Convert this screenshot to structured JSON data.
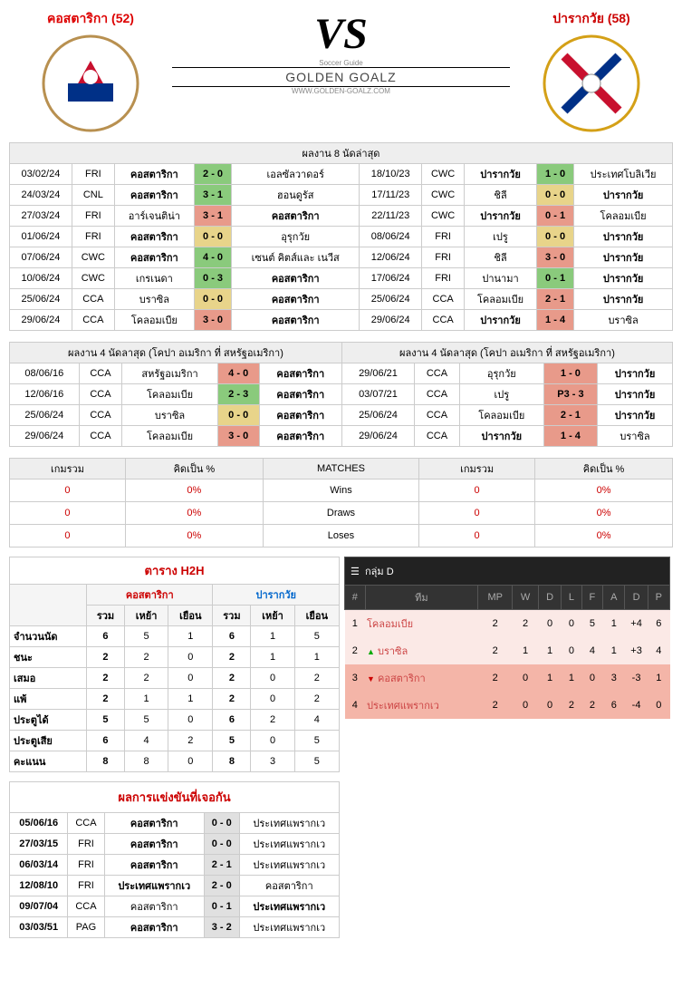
{
  "header": {
    "team_left": "คอสตาริกา (52)",
    "team_right": "ปารากวัย (58)",
    "vs": "VS",
    "logo_top": "Soccer Guide",
    "logo_main": "GOLDEN GOALZ",
    "logo_sub": "WWW.GOLDEN-GOALZ.COM"
  },
  "last8": {
    "title": "ผลงาน 8 นัดล่าสุด",
    "left": [
      {
        "date": "03/02/24",
        "comp": "FRI",
        "home": "คอสตาริกา",
        "score": "2 - 0",
        "cls": "green",
        "away": "เอลซัลวาดอร์",
        "hb": true
      },
      {
        "date": "24/03/24",
        "comp": "CNL",
        "home": "คอสตาริกา",
        "score": "3 - 1",
        "cls": "green",
        "away": "ฮอนดูรัส",
        "hb": true
      },
      {
        "date": "27/03/24",
        "comp": "FRI",
        "home": "อาร์เจนติน่า",
        "score": "3 - 1",
        "cls": "red",
        "away": "คอสตาริกา",
        "ab": true
      },
      {
        "date": "01/06/24",
        "comp": "FRI",
        "home": "คอสตาริกา",
        "score": "0 - 0",
        "cls": "yellow",
        "away": "อุรุกวัย",
        "hb": true
      },
      {
        "date": "07/06/24",
        "comp": "CWC",
        "home": "คอสตาริกา",
        "score": "4 - 0",
        "cls": "green",
        "away": "เซนต์ คิตส์และ เนวีส",
        "hb": true
      },
      {
        "date": "10/06/24",
        "comp": "CWC",
        "home": "เกรเนดา",
        "score": "0 - 3",
        "cls": "green",
        "away": "คอสตาริกา",
        "ab": true
      },
      {
        "date": "25/06/24",
        "comp": "CCA",
        "home": "บราซิล",
        "score": "0 - 0",
        "cls": "yellow",
        "away": "คอสตาริกา",
        "ab": true
      },
      {
        "date": "29/06/24",
        "comp": "CCA",
        "home": "โคลอมเบีย",
        "score": "3 - 0",
        "cls": "red",
        "away": "คอสตาริกา",
        "ab": true
      }
    ],
    "right": [
      {
        "date": "18/10/23",
        "comp": "CWC",
        "home": "ปารากวัย",
        "score": "1 - 0",
        "cls": "green",
        "away": "ประเทศโบลิเวีย",
        "hb": true
      },
      {
        "date": "17/11/23",
        "comp": "CWC",
        "home": "ชิลี",
        "score": "0 - 0",
        "cls": "yellow",
        "away": "ปารากวัย",
        "ab": true
      },
      {
        "date": "22/11/23",
        "comp": "CWC",
        "home": "ปารากวัย",
        "score": "0 - 1",
        "cls": "red",
        "away": "โคลอมเบีย",
        "hb": true
      },
      {
        "date": "08/06/24",
        "comp": "FRI",
        "home": "เปรู",
        "score": "0 - 0",
        "cls": "yellow",
        "away": "ปารากวัย",
        "ab": true
      },
      {
        "date": "12/06/24",
        "comp": "FRI",
        "home": "ชิลี",
        "score": "3 - 0",
        "cls": "red",
        "away": "ปารากวัย",
        "ab": true
      },
      {
        "date": "17/06/24",
        "comp": "FRI",
        "home": "ปานามา",
        "score": "0 - 1",
        "cls": "green",
        "away": "ปารากวัย",
        "ab": true
      },
      {
        "date": "25/06/24",
        "comp": "CCA",
        "home": "โคลอมเบีย",
        "score": "2 - 1",
        "cls": "red",
        "away": "ปารากวัย",
        "ab": true
      },
      {
        "date": "29/06/24",
        "comp": "CCA",
        "home": "ปารากวัย",
        "score": "1 - 4",
        "cls": "red",
        "away": "บราซิล",
        "hb": true
      }
    ]
  },
  "last4": {
    "title_left": "ผลงาน 4 นัดลาสุด (โคปา อเมริกา ที่ สหรัฐอเมริกา)",
    "title_right": "ผลงาน 4 นัดลาสุด (โคปา อเมริกา ที่ สหรัฐอเมริกา)",
    "left": [
      {
        "date": "08/06/16",
        "comp": "CCA",
        "home": "สหรัฐอเมริกา",
        "score": "4 - 0",
        "cls": "red",
        "away": "คอสตาริกา",
        "ab": true
      },
      {
        "date": "12/06/16",
        "comp": "CCA",
        "home": "โคลอมเบีย",
        "score": "2 - 3",
        "cls": "green",
        "away": "คอสตาริกา",
        "ab": true
      },
      {
        "date": "25/06/24",
        "comp": "CCA",
        "home": "บราซิล",
        "score": "0 - 0",
        "cls": "yellow",
        "away": "คอสตาริกา",
        "ab": true
      },
      {
        "date": "29/06/24",
        "comp": "CCA",
        "home": "โคลอมเบีย",
        "score": "3 - 0",
        "cls": "red",
        "away": "คอสตาริกา",
        "ab": true
      }
    ],
    "right": [
      {
        "date": "29/06/21",
        "comp": "CCA",
        "home": "อุรุกวัย",
        "score": "1 - 0",
        "cls": "red",
        "away": "ปารากวัย",
        "ab": true
      },
      {
        "date": "03/07/21",
        "comp": "CCA",
        "home": "เปรู",
        "score": "P3 - 3",
        "cls": "red",
        "away": "ปารากวัย",
        "ab": true
      },
      {
        "date": "25/06/24",
        "comp": "CCA",
        "home": "โคลอมเบีย",
        "score": "2 - 1",
        "cls": "red",
        "away": "ปารากวัย",
        "ab": true
      },
      {
        "date": "29/06/24",
        "comp": "CCA",
        "home": "ปารากวัย",
        "score": "1 - 4",
        "cls": "red",
        "away": "บราซิล",
        "hb": true
      }
    ]
  },
  "summary": {
    "headers": [
      "เกมรวม",
      "คิดเป็น %",
      "MATCHES",
      "เกมรวม",
      "คิดเป็น %"
    ],
    "rows": [
      {
        "l1": "0",
        "l2": "0%",
        "label": "Wins",
        "r1": "0",
        "r2": "0%"
      },
      {
        "l1": "0",
        "l2": "0%",
        "label": "Draws",
        "r1": "0",
        "r2": "0%"
      },
      {
        "l1": "0",
        "l2": "0%",
        "label": "Loses",
        "r1": "0",
        "r2": "0%"
      }
    ]
  },
  "h2h": {
    "title": "ตาราง H2H",
    "team_left": "คอสตาริกา",
    "team_right": "ปารากวัย",
    "cols": [
      "รวม",
      "เหย้า",
      "เยือน",
      "รวม",
      "เหย้า",
      "เยือน"
    ],
    "rows": [
      {
        "label": "จำนวนนัด",
        "v": [
          "6",
          "5",
          "1",
          "6",
          "1",
          "5"
        ],
        "bold": [
          0,
          3
        ]
      },
      {
        "label": "ชนะ",
        "v": [
          "2",
          "2",
          "0",
          "2",
          "1",
          "1"
        ],
        "bold": [
          0,
          3
        ]
      },
      {
        "label": "เสมอ",
        "v": [
          "2",
          "2",
          "0",
          "2",
          "0",
          "2"
        ],
        "bold": [
          0,
          3
        ]
      },
      {
        "label": "แพ้",
        "v": [
          "2",
          "1",
          "1",
          "2",
          "0",
          "2"
        ],
        "bold": [
          0,
          3
        ]
      },
      {
        "label": "ประตูได้",
        "v": [
          "5",
          "5",
          "0",
          "6",
          "2",
          "4"
        ],
        "bold": [
          0,
          3
        ]
      },
      {
        "label": "ประตูเสีย",
        "v": [
          "6",
          "4",
          "2",
          "5",
          "0",
          "5"
        ],
        "bold": [
          0,
          3
        ]
      },
      {
        "label": "คะแนน",
        "v": [
          "8",
          "8",
          "0",
          "8",
          "3",
          "5"
        ],
        "bold": [
          0,
          3
        ]
      }
    ]
  },
  "group": {
    "title": "กลุ่ม D",
    "cols": [
      "#",
      "ทีม",
      "MP",
      "W",
      "D",
      "L",
      "F",
      "A",
      "D",
      "P"
    ],
    "rows": [
      {
        "rank": "1",
        "arrow": "",
        "team": "โคลอมเบีย",
        "v": [
          "2",
          "2",
          "0",
          "0",
          "5",
          "1",
          "+4",
          "6"
        ],
        "cls": "group-row-light"
      },
      {
        "rank": "2",
        "arrow": "▲",
        "team": "บราซิล",
        "v": [
          "2",
          "1",
          "1",
          "0",
          "4",
          "1",
          "+3",
          "4"
        ],
        "cls": "group-row-light"
      },
      {
        "rank": "3",
        "arrow": "▼",
        "team": "คอสตาริกา",
        "v": [
          "2",
          "0",
          "1",
          "1",
          "0",
          "3",
          "-3",
          "1"
        ],
        "cls": "group-row-dark"
      },
      {
        "rank": "4",
        "arrow": "",
        "team": "ประเทศแพรากเว",
        "v": [
          "2",
          "0",
          "0",
          "2",
          "2",
          "6",
          "-4",
          "0"
        ],
        "cls": "group-row-dark"
      }
    ]
  },
  "encounters": {
    "title": "ผลการแข่งขันที่เจอกัน",
    "rows": [
      {
        "date": "05/06/16",
        "comp": "CCA",
        "home": "คอสตาริกา",
        "score": "0 - 0",
        "away": "ประเทศแพรากเว",
        "hb": true
      },
      {
        "date": "27/03/15",
        "comp": "FRI",
        "home": "คอสตาริกา",
        "score": "0 - 0",
        "away": "ประเทศแพรากเว",
        "hb": true
      },
      {
        "date": "06/03/14",
        "comp": "FRI",
        "home": "คอสตาริกา",
        "score": "2 - 1",
        "away": "ประเทศแพรากเว",
        "hb": true
      },
      {
        "date": "12/08/10",
        "comp": "FRI",
        "home": "ประเทศแพรากเว",
        "score": "2 - 0",
        "away": "คอสตาริกา",
        "hb": true
      },
      {
        "date": "09/07/04",
        "comp": "CCA",
        "home": "คอสตาริกา",
        "score": "0 - 1",
        "away": "ประเทศแพรากเว",
        "ab": true
      },
      {
        "date": "03/03/51",
        "comp": "PAG",
        "home": "คอสตาริกา",
        "score": "3 - 2",
        "away": "ประเทศแพรากเว",
        "hb": true
      }
    ]
  }
}
